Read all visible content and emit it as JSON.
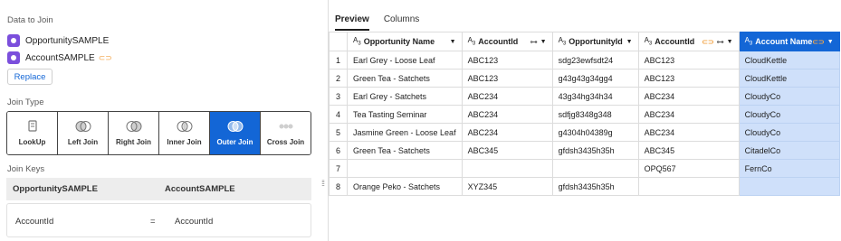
{
  "left_panel": {
    "data_to_join_label": "Data to Join",
    "datasources": [
      {
        "name": "OpportunitySAMPLE"
      },
      {
        "name": "AccountSAMPLE"
      }
    ],
    "replace_label": "Replace",
    "join_type_label": "Join Type",
    "join_types": [
      {
        "label": "LookUp"
      },
      {
        "label": "Left Join"
      },
      {
        "label": "Right Join"
      },
      {
        "label": "Inner Join"
      },
      {
        "label": "Outer Join",
        "active": true
      },
      {
        "label": "Cross Join"
      }
    ],
    "join_keys_label": "Join Keys",
    "keys_header_left": "OpportunitySAMPLE",
    "keys_header_right": "AccountSAMPLE",
    "key_left": "AccountId",
    "key_operator": "=",
    "key_right": "AccountId"
  },
  "right_panel": {
    "tabs": [
      {
        "label": "Preview",
        "active": true
      },
      {
        "label": "Columns"
      }
    ],
    "type_glyph": "A",
    "type_sub": "3",
    "columns": [
      "Opportunity Name",
      "AccountId",
      "OpportunityId",
      "AccountId",
      "Account Name"
    ],
    "rows": [
      {
        "n": "1",
        "cells": [
          "Earl Grey - Loose Leaf",
          "ABC123",
          "sdg23ewfsdt24",
          "ABC123",
          "CloudKettle"
        ]
      },
      {
        "n": "2",
        "cells": [
          "Green Tea - Satchets",
          "ABC123",
          "g43g43g34gg4",
          "ABC123",
          "CloudKettle"
        ]
      },
      {
        "n": "3",
        "cells": [
          "Earl Grey - Satchets",
          "ABC234",
          "43g34hg34h34",
          "ABC234",
          "CloudyCo"
        ]
      },
      {
        "n": "4",
        "cells": [
          "Tea Tasting Seminar",
          "ABC234",
          "sdfjg8348g348",
          "ABC234",
          "CloudyCo"
        ]
      },
      {
        "n": "5",
        "cells": [
          "Jasmine Green - Loose Leaf",
          "ABC234",
          "g4304h04389g",
          "ABC234",
          "CloudyCo"
        ]
      },
      {
        "n": "6",
        "cells": [
          "Green Tea - Satchets",
          "ABC345",
          "gfdsh3435h35h",
          "ABC345",
          "CitadelCo"
        ]
      },
      {
        "n": "7",
        "cells": [
          "",
          "",
          "",
          "OPQ567",
          "FernCo"
        ]
      },
      {
        "n": "8",
        "cells": [
          "Orange Peko - Satchets",
          "XYZ345",
          "gfdsh3435h35h",
          "",
          ""
        ]
      }
    ]
  },
  "colors": {
    "accent": "#1366d6",
    "source_icon": "#7b4fdc",
    "key_marker": "#f2a54a",
    "selected_column_bg": "#cfe0fa"
  }
}
